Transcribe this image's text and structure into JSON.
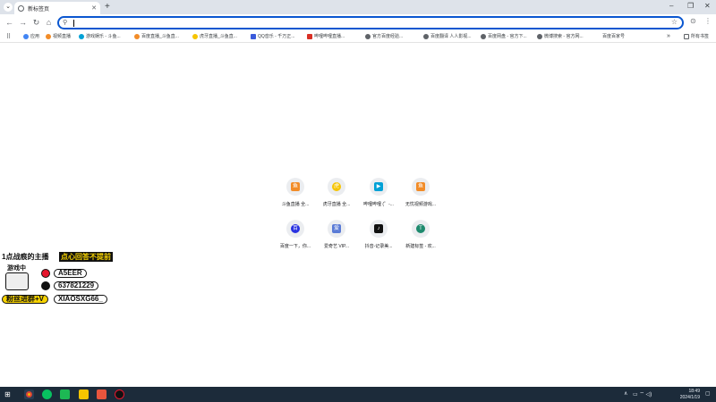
{
  "tab": {
    "title": "新标签页"
  },
  "toolbar": {
    "omnibox_value": ""
  },
  "bookmarks": [
    "应用",
    "视频直播",
    "游戏娱乐 - 斗鱼...",
    "百度直播_斗鱼直...",
    "虎牙直播_斗鱼直...",
    "QQ音乐 - 千万正...",
    "哔哩哔哩直播...",
    "官方百度经验...",
    "百度翻译 人人影视...",
    "百度网盘 - 官方下...",
    "微博搜索 - 官方网...",
    "百度百家号",
    "所有书签"
  ],
  "shortcuts": [
    {
      "label": "斗鱼直播 全...",
      "icon": "douyu-icon",
      "color": "#f28c28"
    },
    {
      "label": "虎牙直播 全...",
      "icon": "huya-icon",
      "color": "#f6c400"
    },
    {
      "label": "哔哩哔哩 (゜-...",
      "icon": "bilibili-icon",
      "color": "#00a1d6"
    },
    {
      "label": "无忧视频游戏...",
      "icon": "douyu-icon",
      "color": "#f28c28"
    },
    {
      "label": "百度一下，你...",
      "icon": "baidu-icon",
      "color": "#2932e1"
    },
    {
      "label": "爱奇艺 VIP...",
      "icon": "iqiyi-icon",
      "color": "#5a7bd6"
    },
    {
      "label": "抖音-记录美...",
      "icon": "tiktok-icon",
      "color": "#111111"
    },
    {
      "label": "新建标签 - 欢...",
      "icon": "teal-t-icon",
      "color": "#1e8a6e"
    }
  ],
  "overlay": {
    "line1": "1点战痕的主播",
    "line1_highlight": "点心回答不提前",
    "status": "游戏中",
    "weibo": "A5EER",
    "qq": "637821229",
    "fans_label": "粉丝进群+V",
    "wechat": "XIAOSXG66_"
  },
  "tray": {
    "time": "18:49",
    "date": "2024/1/19"
  }
}
